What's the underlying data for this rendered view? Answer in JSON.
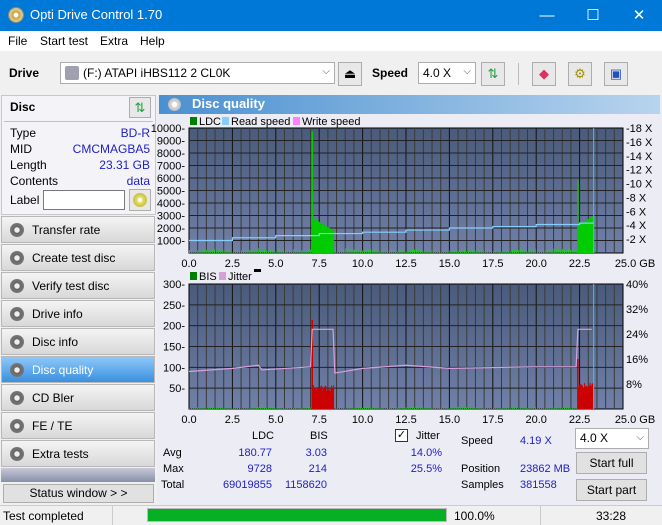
{
  "window": {
    "title": "Opti Drive Control 1.70",
    "minimize": "—",
    "maximize": "☐",
    "close": "✕"
  },
  "menu": [
    "File",
    "Start test",
    "Extra",
    "Help"
  ],
  "toolbar": {
    "drive_label": "Drive",
    "drive_value": "(F:)  ATAPI iHBS112  2 CL0K",
    "speed_label": "Speed",
    "speed_value": "4.0 X"
  },
  "disc": {
    "title": "Disc",
    "fields": [
      {
        "label": "Type",
        "value": "BD-R"
      },
      {
        "label": "MID",
        "value": "CMCMAGBA5"
      },
      {
        "label": "Length",
        "value": "23.31 GB"
      },
      {
        "label": "Contents",
        "value": "data"
      }
    ],
    "label_field": "Label",
    "label_value": ""
  },
  "nav": [
    {
      "label": "Transfer rate",
      "active": false
    },
    {
      "label": "Create test disc",
      "active": false
    },
    {
      "label": "Verify test disc",
      "active": false
    },
    {
      "label": "Drive info",
      "active": false
    },
    {
      "label": "Disc info",
      "active": false
    },
    {
      "label": "Disc quality",
      "active": true
    },
    {
      "label": "CD Bler",
      "active": false
    },
    {
      "label": "FE / TE",
      "active": false
    },
    {
      "label": "Extra tests",
      "active": false
    }
  ],
  "status_window_button": "Status window > >",
  "panel": {
    "title": "Disc quality"
  },
  "chart_data": [
    {
      "type": "bar",
      "title": "LDC / Read speed",
      "legend": [
        "LDC",
        "Read speed",
        "Write speed"
      ],
      "legend_colors": [
        "#008000",
        "#87cefa",
        "#ff80ff"
      ],
      "xlabel": "GB",
      "xlim": [
        0,
        25
      ],
      "x_ticks": [
        "0.0",
        "2.5",
        "5.0",
        "7.5",
        "10.0",
        "12.5",
        "15.0",
        "17.5",
        "20.0",
        "22.5",
        "25.0 GB"
      ],
      "ylim": [
        0,
        10000
      ],
      "y_ticks": [
        "10000",
        "9000",
        "8000",
        "7000",
        "6000",
        "5000",
        "4000",
        "3000",
        "2000",
        "1000"
      ],
      "y2lim": [
        0,
        18
      ],
      "y2_ticks": [
        "18 X",
        "16 X",
        "14 X",
        "12 X",
        "10 X",
        "8 X",
        "6 X",
        "4 X",
        "2 X"
      ],
      "ldc_bursts": [
        {
          "x_start": 7.1,
          "x_end": 8.3,
          "peak": 9728,
          "start_level": 2800,
          "end_level": 1800
        },
        {
          "x_start": 22.4,
          "x_end": 23.3,
          "peak": 5800,
          "start_level": 2200,
          "end_level": 3000
        }
      ],
      "read_speed": [
        [
          0,
          1.8
        ],
        [
          2.5,
          2.2
        ],
        [
          5,
          2.5
        ],
        [
          7.5,
          2.8
        ],
        [
          10,
          3.0
        ],
        [
          12.5,
          3.3
        ],
        [
          15,
          3.6
        ],
        [
          17.5,
          3.8
        ],
        [
          20,
          4.1
        ],
        [
          22.5,
          4.3
        ],
        [
          23.3,
          4.5
        ]
      ],
      "end_marker_x": 23.31
    },
    {
      "type": "bar",
      "title": "BIS / Jitter",
      "legend": [
        "BIS",
        "Jitter"
      ],
      "legend_colors": [
        "#008000",
        "#d8a0d8"
      ],
      "xlabel": "GB",
      "xlim": [
        0,
        25
      ],
      "x_ticks": [
        "0.0",
        "2.5",
        "5.0",
        "7.5",
        "10.0",
        "12.5",
        "15.0",
        "17.5",
        "20.0",
        "22.5",
        "25.0 GB"
      ],
      "ylim": [
        0,
        300
      ],
      "y_ticks": [
        "300",
        "250",
        "200",
        "150",
        "100",
        "50"
      ],
      "y2lim": [
        0,
        40
      ],
      "y2_ticks": [
        "40%",
        "32%",
        "24%",
        "16%",
        "8%"
      ],
      "bis_bursts": [
        {
          "x_start": 7.1,
          "x_end": 8.3,
          "peak": 214,
          "level": 50
        },
        {
          "x_start": 22.4,
          "x_end": 23.3,
          "peak": 120,
          "level": 55
        }
      ],
      "jitter_pct": [
        [
          0,
          12
        ],
        [
          2.5,
          13
        ],
        [
          4,
          14
        ],
        [
          4.2,
          12.5
        ],
        [
          7,
          13.5
        ],
        [
          7.1,
          25.5
        ],
        [
          8.3,
          25.5
        ],
        [
          8.4,
          11.5
        ],
        [
          10,
          13
        ],
        [
          12.5,
          14
        ],
        [
          15,
          13
        ],
        [
          20,
          13.5
        ],
        [
          22.3,
          13.5
        ],
        [
          22.4,
          25.5
        ],
        [
          23.2,
          25.5
        ]
      ],
      "end_marker_x": 23.31
    }
  ],
  "stats": {
    "col_ldc": "LDC",
    "col_bis": "BIS",
    "jitter_label": "Jitter",
    "jitter_checked": true,
    "rows": [
      {
        "label": "Avg",
        "ldc": "180.77",
        "bis": "3.03",
        "jitter": "14.0%"
      },
      {
        "label": "Max",
        "ldc": "9728",
        "bis": "214",
        "jitter": "25.5%"
      },
      {
        "label": "Total",
        "ldc": "69019855",
        "bis": "1158620",
        "jitter": ""
      }
    ],
    "speed_label": "Speed",
    "speed_value": "4.19 X",
    "position_label": "Position",
    "position_value": "23862 MB",
    "samples_label": "Samples",
    "samples_value": "381558",
    "speed_select": "4.0 X",
    "start_full": "Start full",
    "start_part": "Start part"
  },
  "status": {
    "text": "Test completed",
    "progress": 1.0,
    "progress_text": "100.0%",
    "time": "33:28"
  }
}
